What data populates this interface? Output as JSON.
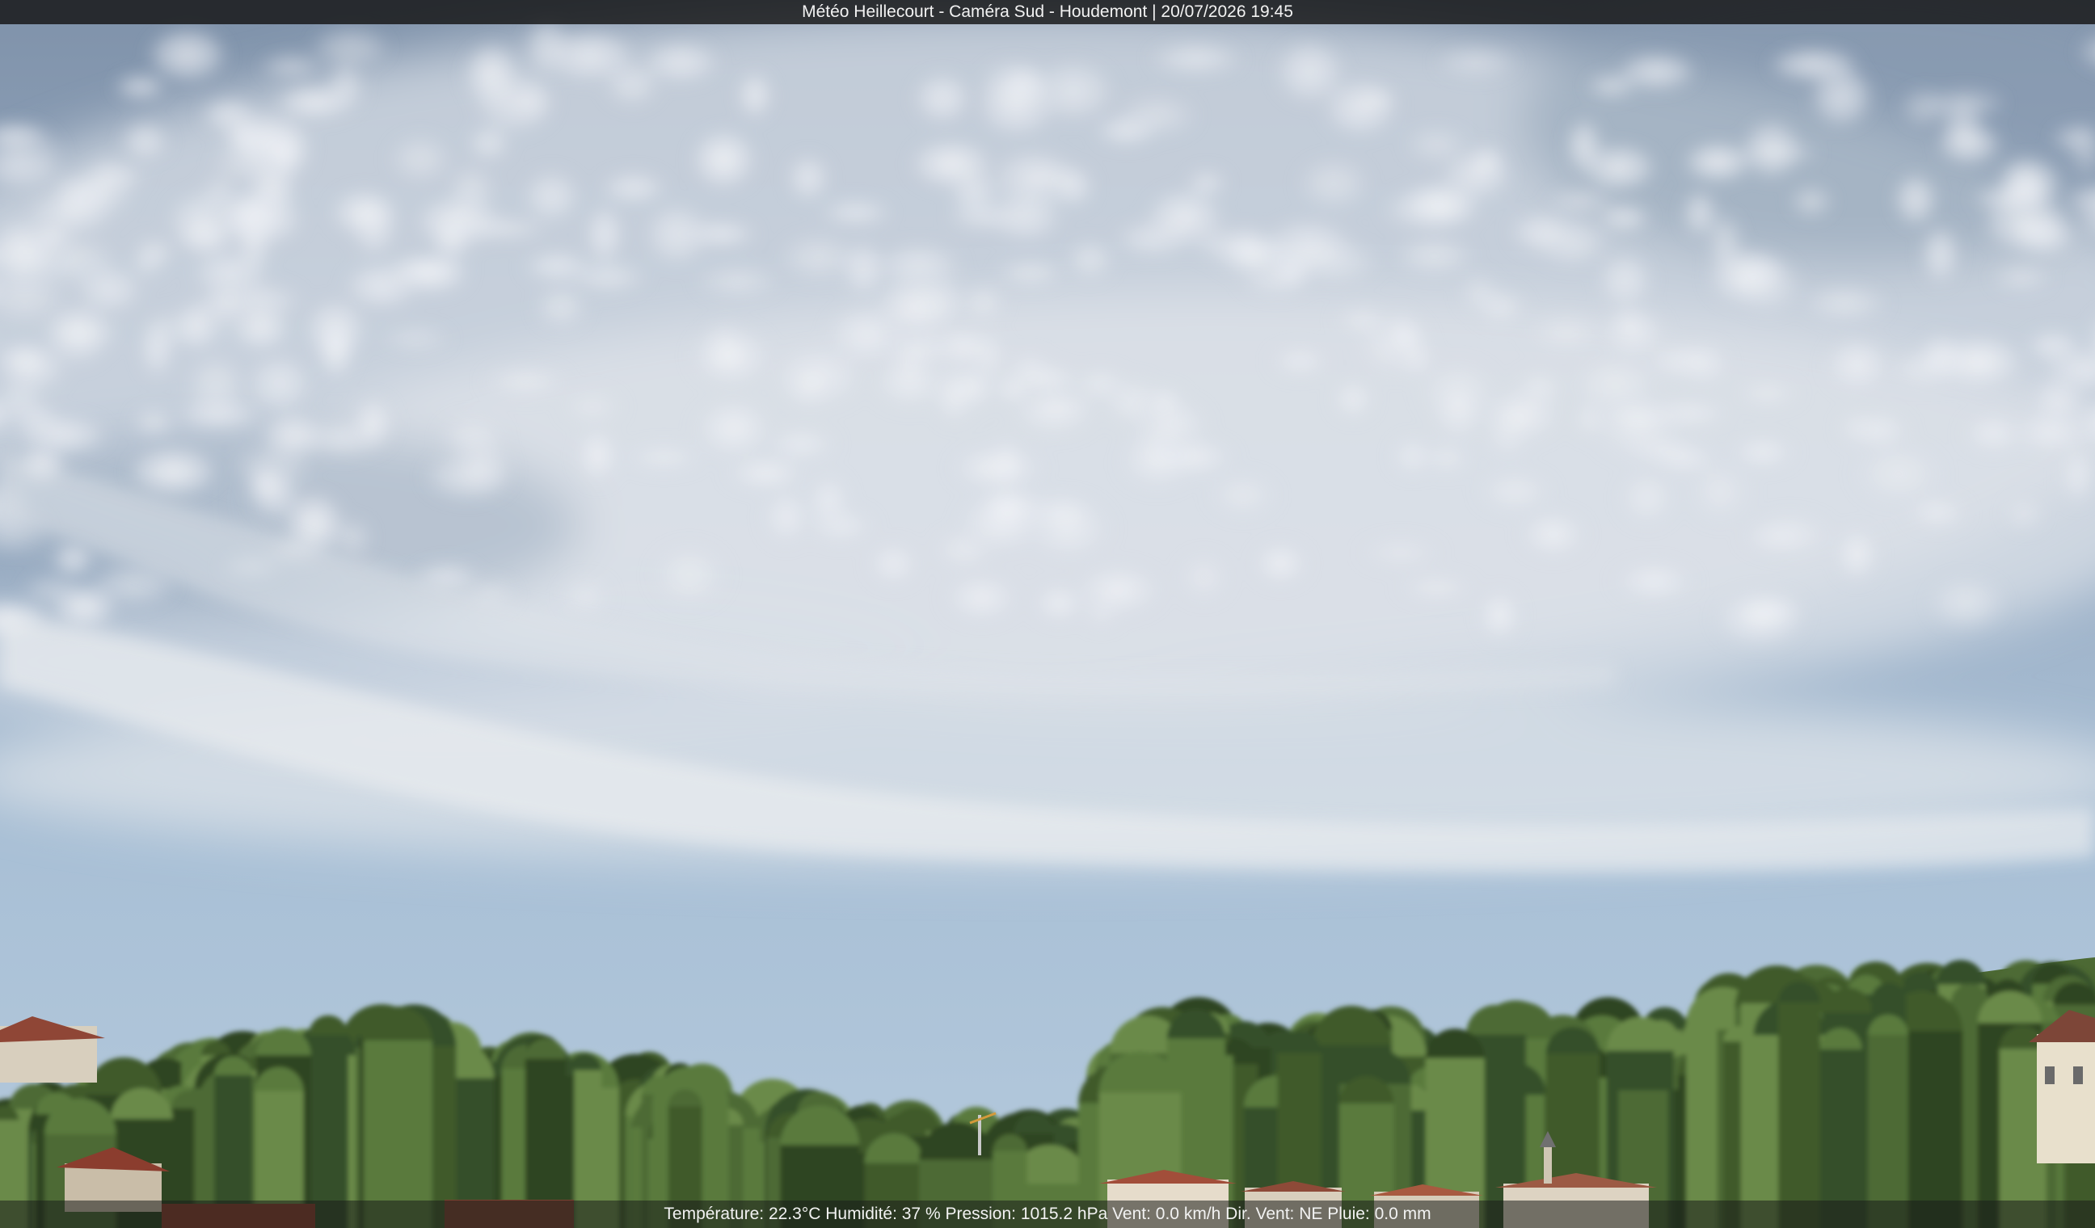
{
  "header": {
    "caption": "Météo Heillecourt - Caméra Sud - Houdemont | 20/07/2026 19:45"
  },
  "footer": {
    "readout": "Température: 22.3°C  Humidité: 37 % Pression: 1015.2 hPa Vent: 0.0 km/h Dir. Vent: NE Pluie: 0.0 mm"
  },
  "colors": {
    "sky_top": "#8a9cb2",
    "sky_bottom": "#a8c0d8",
    "cloud": "#e6e9ee",
    "foliage": "#3f5a2c",
    "roof": "#9a4a35"
  }
}
